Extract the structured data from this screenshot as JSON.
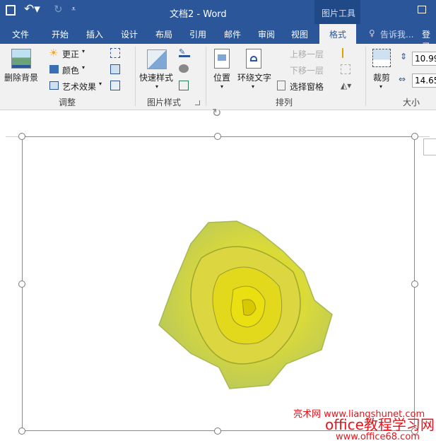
{
  "title": "文档2 - Word",
  "context_tab": "图片工具",
  "tabs": [
    "文件",
    "开始",
    "插入",
    "设计",
    "布局",
    "引用",
    "邮件",
    "审阅",
    "视图",
    "格式"
  ],
  "tell_me": "告诉我...",
  "login": "登录",
  "ribbon": {
    "remove_bg": "删除背景",
    "corrections": "更正",
    "color": "颜色",
    "artistic": "艺术效果",
    "group_adjust": "调整",
    "quick_styles": "快速样式",
    "group_styles": "图片样式",
    "position": "位置",
    "wrap_text": "环绕文字",
    "bring_forward": "上移一层",
    "send_backward": "下移一层",
    "selection_pane": "选择窗格",
    "group_arrange": "排列",
    "crop": "裁剪",
    "height": "10.99",
    "width": "14.65",
    "group_size": "大小"
  },
  "watermark": {
    "line1": "亮术网 www.liangshunet.com",
    "line2": "office教程学习网",
    "line3": "www.office68.com"
  },
  "colors": {
    "brand": "#2b579a"
  }
}
